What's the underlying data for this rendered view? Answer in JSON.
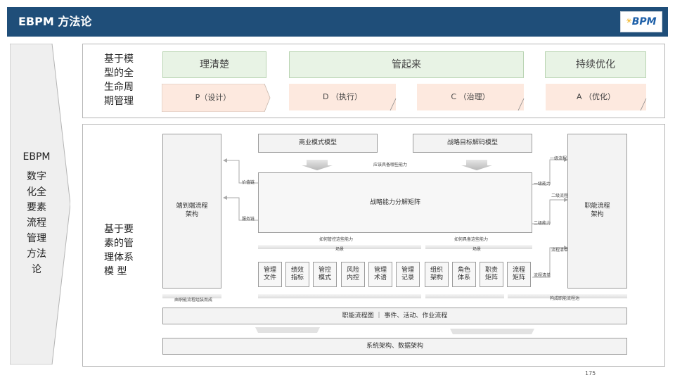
{
  "header": {
    "title": "EBPM 方法论",
    "logo_text": "BPM"
  },
  "left": {
    "label_top": "EBPM",
    "label_lines": [
      "数字",
      "化全",
      "要素",
      "流程",
      "管理",
      "方法",
      "论"
    ]
  },
  "top": {
    "side_label_lines": [
      "基于模",
      "型的全",
      "生命周",
      "期管理"
    ],
    "phases": [
      "理清楚",
      "管起来",
      "持续优化"
    ],
    "steps": [
      "P（设计）",
      "D （执行）",
      "C （治理）",
      "A （优化）"
    ]
  },
  "bottom": {
    "side_label_lines": [
      "基于要",
      "素的管",
      "理体系",
      "模 型"
    ],
    "left_col": "端到端流程\n架构",
    "right_col": "职能流程\n架构",
    "model_boxes": [
      "商业模式模型",
      "战略目标解码模型"
    ],
    "capability_caption": "应该具备哪些能力",
    "center_box": "战略能力分解矩阵",
    "left_arrow_labels": [
      "价值链",
      "服务链"
    ],
    "right_arrow_labels": [
      "一级流程",
      "一级能力",
      "二级流程",
      "二级能力",
      "流程清单",
      "流程清单"
    ],
    "control_caption": "如何管控这些能力",
    "prepare_caption": "如何具备这些能力",
    "scene_label": "场景",
    "cells": [
      "管理\n文件",
      "绩效\n指标",
      "管控\n模式",
      "风险\n内控",
      "管理\n术语",
      "管理\n记录",
      "组织\n架构",
      "角色\n体系",
      "职责\n矩阵",
      "流程\n矩阵"
    ],
    "left_footer": "由职能流程组装而成",
    "right_footer": "构成职能流程池",
    "process_bar": "职能流程图 ｜ 事件、活动、作业流程",
    "system_bar": "系统架构、数据架构"
  },
  "page_number": "175"
}
